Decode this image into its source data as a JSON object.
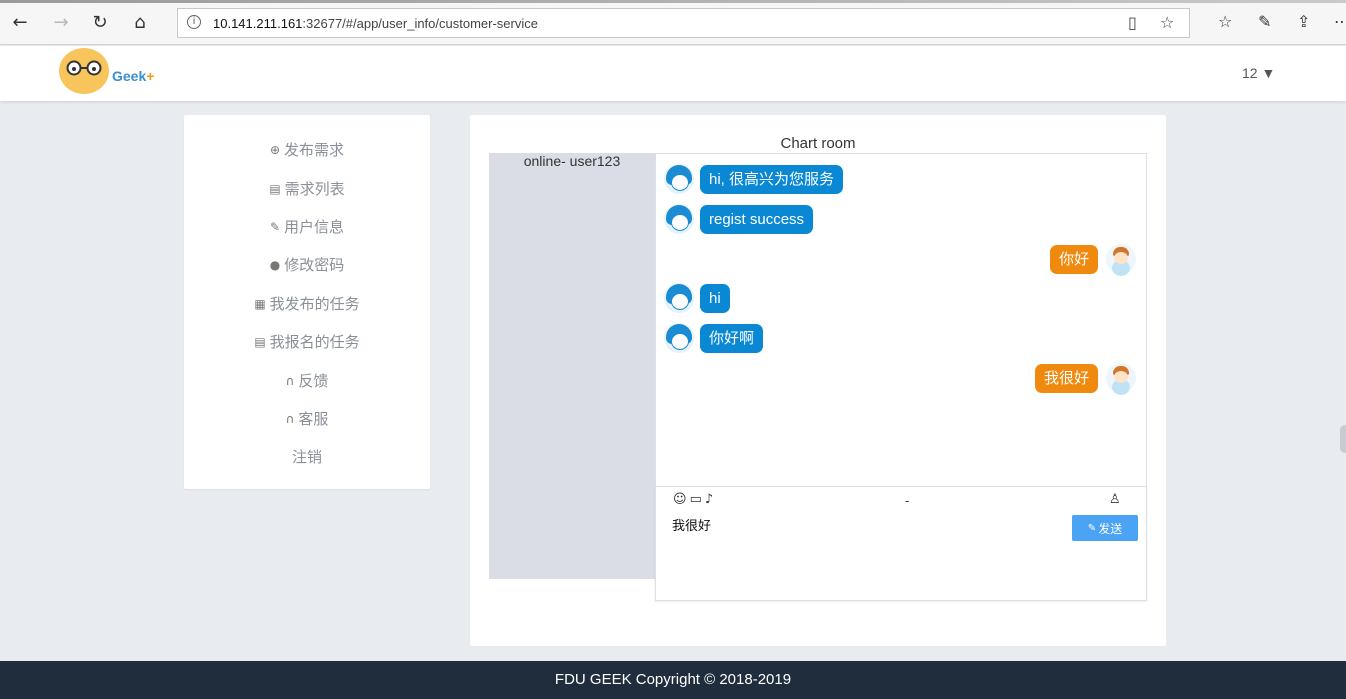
{
  "browser": {
    "url_host": "10.141.211.161",
    "url_rest": ":32677/#/app/user_info/customer-service",
    "back_icon": "←",
    "forward_icon": "→",
    "refresh_icon": "↻",
    "home_icon": "⌂"
  },
  "header": {
    "logo_text": "Geek",
    "logo_plus": "+",
    "user_menu": "12 ▼"
  },
  "sidebar": {
    "items": [
      {
        "icon": "⊕",
        "label": "发布需求"
      },
      {
        "icon": "▤",
        "label": "需求列表"
      },
      {
        "icon": "✎",
        "label": "用户信息"
      },
      {
        "icon": "●",
        "label": "修改密码"
      },
      {
        "icon": "▦",
        "label": "我发布的任务"
      },
      {
        "icon": "▤",
        "label": "我报名的任务"
      },
      {
        "icon": "∩",
        "label": "反馈"
      },
      {
        "icon": "∩",
        "label": "客服"
      },
      {
        "icon": "",
        "label": "注销"
      }
    ]
  },
  "chat": {
    "title": "Chart room",
    "online_label": "online- user123",
    "messages": [
      {
        "side": "left",
        "text": "hi, 很高兴为您服务"
      },
      {
        "side": "left",
        "text": "regist success"
      },
      {
        "side": "right",
        "text": "你好"
      },
      {
        "side": "left",
        "text": "hi"
      },
      {
        "side": "left",
        "text": "你好啊"
      },
      {
        "side": "right",
        "text": "我很好"
      }
    ],
    "composer": {
      "separator": "-",
      "input_value": "我很好",
      "send_label": "发送",
      "send_icon": "✎",
      "emoji_icon": "☺",
      "folder_icon": "▭",
      "mic_icon": "♪",
      "user_icon": "♙"
    }
  },
  "footer": {
    "copyright": "FDU GEEK Copyright © 2018-2019"
  },
  "colors": {
    "service_bubble": "#0a88d4",
    "user_bubble": "#f08a0e",
    "send_button": "#4aa3f5",
    "footer_bg": "#1f2d3d",
    "page_bg": "#e8ecf0"
  }
}
